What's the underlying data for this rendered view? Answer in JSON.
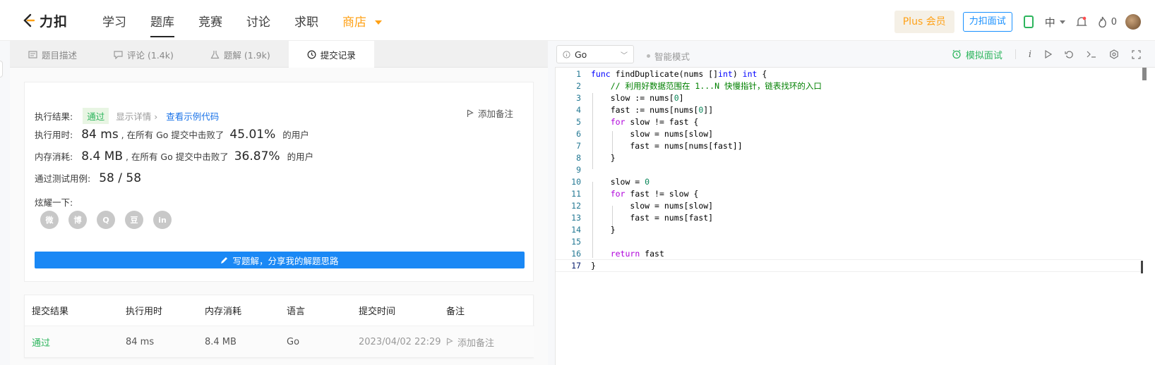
{
  "topnav": {
    "logo_text": "力扣",
    "items": [
      "学习",
      "题库",
      "竞赛",
      "讨论",
      "求职"
    ],
    "shop": "商店",
    "plus": "Plus 会员",
    "mock_interview": "力扣面试",
    "lang": "中",
    "points": "0"
  },
  "left_tabs": [
    {
      "label": "题目描述",
      "icon": "description-icon"
    },
    {
      "label": "评论 (1.4k)",
      "icon": "comment-icon"
    },
    {
      "label": "题解 (1.9k)",
      "icon": "flask-icon"
    },
    {
      "label": "提交记录",
      "icon": "clock-icon"
    }
  ],
  "result": {
    "label": "执行结果:",
    "status": "通过",
    "details": "显示详情 ›",
    "example_code": "查看示例代码",
    "add_note": "添加备注",
    "time_label": "执行用时:",
    "time_value": "84 ms",
    "time_mid": ", 在所有 Go 提交中击败了",
    "time_pct": "45.01%",
    "time_tail": "的用户",
    "mem_label": "内存消耗:",
    "mem_value": "8.4 MB",
    "mem_mid": ", 在所有 Go 提交中击败了",
    "mem_pct": "36.87%",
    "mem_tail": "的用户",
    "tests_label": "通过测试用例:",
    "tests_value": "58 / 58",
    "share_label": "炫耀一下:",
    "share_icons": [
      "wechat-icon",
      "weibo-icon",
      "qq-icon",
      "douban-icon",
      "linkedin-icon"
    ],
    "share_glyphs": [
      "微",
      "博",
      "Q",
      "豆",
      "in"
    ],
    "write_solution": "写题解，分享我的解题思路"
  },
  "submissions": {
    "headers": [
      "提交结果",
      "执行用时",
      "内存消耗",
      "语言",
      "提交时间",
      "备注"
    ],
    "rows": [
      {
        "result": "通过",
        "time": "84 ms",
        "memory": "8.4 MB",
        "lang": "Go",
        "submitted": "2023/04/02 22:29",
        "note": "添加备注"
      }
    ]
  },
  "editor_bar": {
    "language": "Go",
    "smart_mode": "智能模式",
    "mock_interview": "模拟面试"
  },
  "code": {
    "line_numbers": [
      "1",
      "2",
      "3",
      "4",
      "5",
      "6",
      "7",
      "8",
      "9",
      "10",
      "11",
      "12",
      "13",
      "14",
      "15",
      "16",
      "17"
    ],
    "active_line": 17
  },
  "colors": {
    "accent_orange": "#ffa116",
    "pass_green": "#2db55d",
    "primary_blue": "#1a88f5"
  }
}
